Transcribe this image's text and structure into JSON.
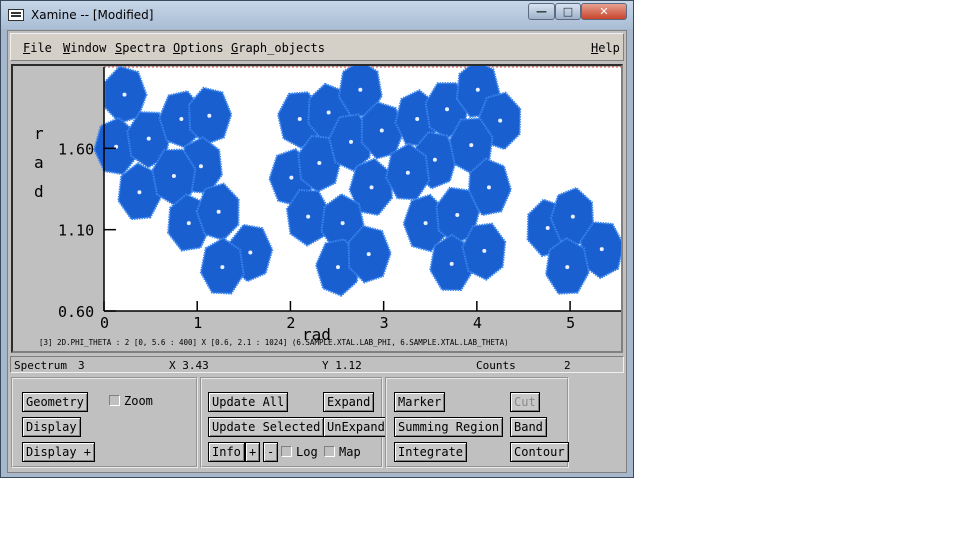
{
  "window": {
    "title": "Xamine --  [Modified]",
    "controls": {
      "minimize": "—",
      "maximize": "□",
      "close": "✕"
    }
  },
  "menu": {
    "file": "File",
    "window": "Window",
    "spectra": "Spectra",
    "options": "Options",
    "graph_objects": "Graph_objects",
    "help": "Help"
  },
  "plot": {
    "ylabel": "r\na\nd",
    "xlabel": "rad",
    "caption": "[3] 2D.PHI_THETA : 2 [0, 5.6 : 400] X [0.6, 2.1 : 1024] (6.SAMPLE.XTAL.LAB_PHI, 6.SAMPLE.XTAL.LAB_THETA)",
    "x_ticks": [
      "0",
      "1",
      "2",
      "3",
      "4",
      "5"
    ],
    "y_ticks": [
      "1.60",
      "1.10",
      "0.60"
    ],
    "colors": {
      "blob_fill": "#1a5fd0",
      "blob_edge": "#3a86f0",
      "center": "#e8f0ff",
      "frame": "#cc4444"
    }
  },
  "chart_data": {
    "type": "heatmap",
    "x_axis": {
      "label": "rad",
      "range": [
        0,
        5.6
      ],
      "ticks": [
        0,
        1,
        2,
        3,
        4,
        5
      ]
    },
    "y_axis": {
      "label": "rad",
      "range": [
        0.6,
        2.1
      ],
      "ticks": [
        0.6,
        1.1,
        1.6
      ]
    },
    "clusters": [
      {
        "x": 0.22,
        "y": 1.93
      },
      {
        "x": 0.13,
        "y": 1.61
      },
      {
        "x": 0.48,
        "y": 1.66
      },
      {
        "x": 0.38,
        "y": 1.33
      },
      {
        "x": 0.83,
        "y": 1.78
      },
      {
        "x": 1.13,
        "y": 1.8
      },
      {
        "x": 1.04,
        "y": 1.49
      },
      {
        "x": 0.75,
        "y": 1.43
      },
      {
        "x": 0.91,
        "y": 1.14
      },
      {
        "x": 1.23,
        "y": 1.21
      },
      {
        "x": 1.57,
        "y": 0.96
      },
      {
        "x": 1.27,
        "y": 0.87
      },
      {
        "x": 2.1,
        "y": 1.78
      },
      {
        "x": 2.41,
        "y": 1.82
      },
      {
        "x": 2.01,
        "y": 1.42
      },
      {
        "x": 2.31,
        "y": 1.51
      },
      {
        "x": 2.75,
        "y": 1.96
      },
      {
        "x": 2.65,
        "y": 1.64
      },
      {
        "x": 2.98,
        "y": 1.71
      },
      {
        "x": 2.87,
        "y": 1.36
      },
      {
        "x": 2.19,
        "y": 1.18
      },
      {
        "x": 2.56,
        "y": 1.14
      },
      {
        "x": 2.51,
        "y": 0.87
      },
      {
        "x": 2.84,
        "y": 0.95
      },
      {
        "x": 3.36,
        "y": 1.78
      },
      {
        "x": 3.68,
        "y": 1.84
      },
      {
        "x": 4.01,
        "y": 1.96
      },
      {
        "x": 4.25,
        "y": 1.77
      },
      {
        "x": 3.55,
        "y": 1.53
      },
      {
        "x": 3.26,
        "y": 1.45
      },
      {
        "x": 3.94,
        "y": 1.62
      },
      {
        "x": 4.13,
        "y": 1.36
      },
      {
        "x": 3.45,
        "y": 1.14
      },
      {
        "x": 3.79,
        "y": 1.19
      },
      {
        "x": 3.73,
        "y": 0.89
      },
      {
        "x": 4.08,
        "y": 0.97
      },
      {
        "x": 4.76,
        "y": 1.11
      },
      {
        "x": 5.03,
        "y": 1.18
      },
      {
        "x": 5.34,
        "y": 0.98
      },
      {
        "x": 4.97,
        "y": 0.87
      }
    ]
  },
  "status": {
    "spectrum_label": "Spectrum",
    "spectrum_value": "3",
    "x_readout": "X 3.43",
    "y_readout": "Y 1.12",
    "counts_label": "Counts",
    "counts_value": "2"
  },
  "panel1": {
    "geometry": "Geometry",
    "zoom": "Zoom",
    "display": "Display",
    "display_plus": "Display +"
  },
  "panel2": {
    "update_all": "Update All",
    "expand": "Expand",
    "update_selected": "Update Selected",
    "unexpand": "UnExpand",
    "info": "Info",
    "plus": "+",
    "minus": "-",
    "log": "Log",
    "map": "Map"
  },
  "panel3": {
    "marker": "Marker",
    "cut": "Cut",
    "summing_region": "Summing Region",
    "band": "Band",
    "integrate": "Integrate",
    "contour": "Contour"
  }
}
